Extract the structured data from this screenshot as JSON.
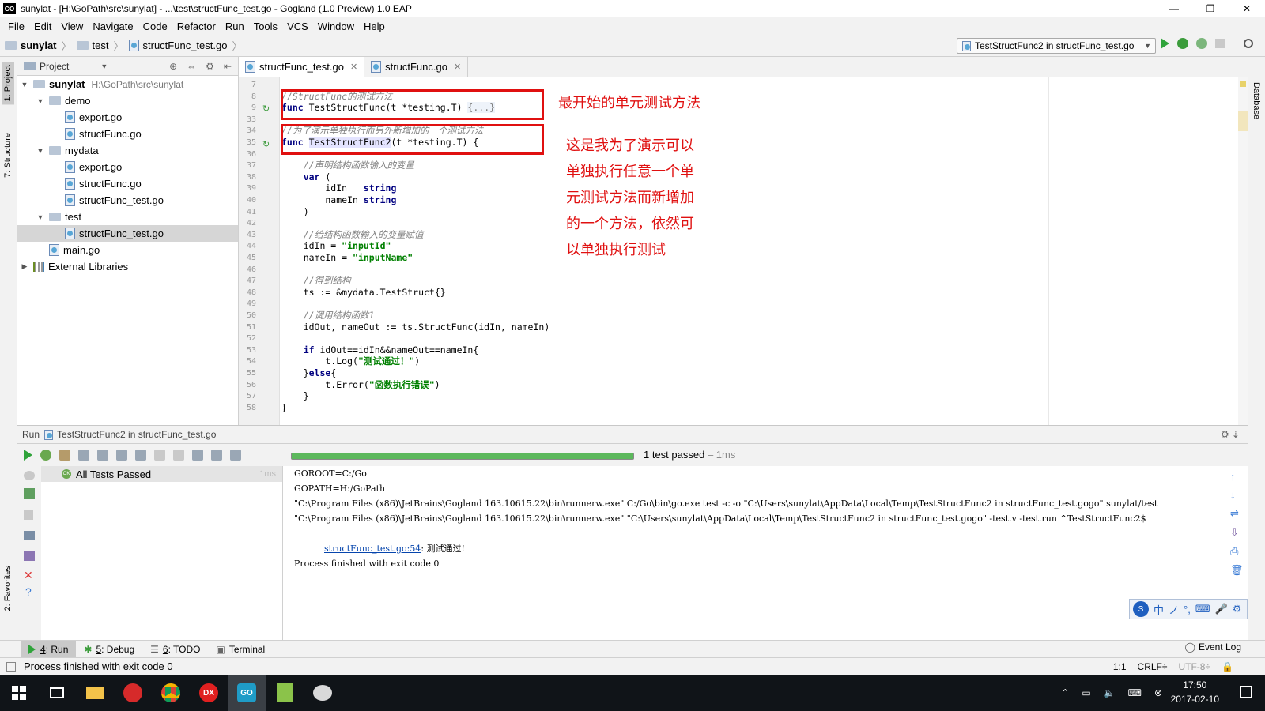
{
  "window": {
    "title": "sunylat - [H:\\GoPath\\src\\sunylat] - ...\\test\\structFunc_test.go - Gogland (1.0 Preview) 1.0 EAP",
    "app_icon": "GO",
    "minimize": "—",
    "maximize": "❐",
    "close": "✕"
  },
  "menu": [
    "File",
    "Edit",
    "View",
    "Navigate",
    "Code",
    "Refactor",
    "Run",
    "Tools",
    "VCS",
    "Window",
    "Help"
  ],
  "breadcrumb": [
    "sunylat",
    "test",
    "structFunc_test.go"
  ],
  "run_config": "TestStructFunc2 in structFunc_test.go",
  "left_stripe": {
    "project": "1: Project",
    "structure": "7: Structure",
    "favorites": "2: Favorites"
  },
  "right_stripe": {
    "database": "Database"
  },
  "project_panel": {
    "title": "Project",
    "root_label": "sunylat",
    "root_path": "H:\\GoPath\\src\\sunylat",
    "tree": [
      {
        "label": "demo",
        "depth": 1,
        "kind": "folder",
        "expanded": true
      },
      {
        "label": "export.go",
        "depth": 2,
        "kind": "file"
      },
      {
        "label": "structFunc.go",
        "depth": 2,
        "kind": "file"
      },
      {
        "label": "mydata",
        "depth": 1,
        "kind": "folder",
        "expanded": true
      },
      {
        "label": "export.go",
        "depth": 2,
        "kind": "file"
      },
      {
        "label": "structFunc.go",
        "depth": 2,
        "kind": "file"
      },
      {
        "label": "structFunc_test.go",
        "depth": 2,
        "kind": "file"
      },
      {
        "label": "test",
        "depth": 1,
        "kind": "folder",
        "expanded": true
      },
      {
        "label": "structFunc_test.go",
        "depth": 2,
        "kind": "file",
        "selected": true
      },
      {
        "label": "main.go",
        "depth": 1,
        "kind": "file"
      },
      {
        "label": "External Libraries",
        "depth": 0,
        "kind": "lib"
      }
    ]
  },
  "editor": {
    "tabs": [
      {
        "label": "structFunc_test.go",
        "active": true
      },
      {
        "label": "structFunc.go",
        "active": false
      }
    ],
    "lines": [
      {
        "num": "7",
        "html": ""
      },
      {
        "num": "8",
        "html": "<span class='cm'>//StructFunc的测试方法</span>"
      },
      {
        "num": "9",
        "html": "<span class='kw'>func</span> TestStructFunc(t *testing.T) <span class='cm' style='font-style:normal;background:#eef3fa'>{...}</span>"
      },
      {
        "num": "33",
        "html": ""
      },
      {
        "num": "34",
        "html": "<span class='cm'>//为了演示单独执行而另外新增加的一个测试方法</span>"
      },
      {
        "num": "35",
        "html": "<span class='kw'>func</span> <span style='background:#e4e4ff'>TestStructFunc2</span>(t *testing.T) {"
      },
      {
        "num": "36",
        "html": ""
      },
      {
        "num": "37",
        "html": "    <span class='cm'>//声明结构函数输入的变量</span>"
      },
      {
        "num": "38",
        "html": "    <span class='kw'>var</span> ("
      },
      {
        "num": "39",
        "html": "        idIn   <span class='kw'>string</span>"
      },
      {
        "num": "40",
        "html": "        nameIn <span class='kw'>string</span>"
      },
      {
        "num": "41",
        "html": "    )"
      },
      {
        "num": "42",
        "html": ""
      },
      {
        "num": "43",
        "html": "    <span class='cm'>//给结构函数输入的变量赋值</span>"
      },
      {
        "num": "44",
        "html": "    idIn = <span class='st'>\"inputId\"</span>"
      },
      {
        "num": "45",
        "html": "    nameIn = <span class='st'>\"inputName\"</span>"
      },
      {
        "num": "46",
        "html": ""
      },
      {
        "num": "47",
        "html": "    <span class='cm'>//得到结构</span>"
      },
      {
        "num": "48",
        "html": "    ts := &amp;mydata.TestStruct{}"
      },
      {
        "num": "49",
        "html": ""
      },
      {
        "num": "50",
        "html": "    <span class='cm'>//调用结构函数1</span>"
      },
      {
        "num": "51",
        "html": "    idOut, nameOut := ts.StructFunc(idIn, nameIn)"
      },
      {
        "num": "52",
        "html": ""
      },
      {
        "num": "53",
        "html": "    <span class='kw'>if</span> idOut==idIn&amp;&amp;nameOut==nameIn{"
      },
      {
        "num": "54",
        "html": "        t.Log(<span class='st'>\"测试通过！\"</span>)"
      },
      {
        "num": "55",
        "html": "    }<span class='kw'>else</span>{"
      },
      {
        "num": "56",
        "html": "        t.Error(<span class='st'>\"函数执行错误\"</span>)"
      },
      {
        "num": "57",
        "html": "    }"
      },
      {
        "num": "58",
        "html": "}"
      }
    ]
  },
  "annotations": {
    "first": "最开始的单元测试方法",
    "second": [
      "这是我为了演示可以",
      "单独执行任意一个单",
      "元测试方法而新增加",
      "的一个方法，依然可",
      "以单独执行测试"
    ]
  },
  "run_panel": {
    "header": "Run",
    "config": "TestStructFunc2 in structFunc_test.go",
    "progress": 1.0,
    "result": "1 test passed",
    "result_time": "– 1ms",
    "tree_item": "All Tests Passed",
    "tree_time": "1ms",
    "console": [
      "GOROOT=C:/Go",
      "GOPATH=H:/GoPath",
      "\"C:\\Program Files (x86)\\JetBrains\\Gogland 163.10615.22\\bin\\runnerw.exe\" C:/Go\\bin\\go.exe test -c -o \"C:\\Users\\sunylat\\AppData\\Local\\Temp\\TestStructFunc2 in structFunc_test.gogo\" sunylat/test",
      "\"C:\\Program Files (x86)\\JetBrains\\Gogland 163.10615.22\\bin\\runnerw.exe\" \"C:\\Users\\sunylat\\AppData\\Local\\Temp\\TestStructFunc2 in structFunc_test.gogo\" -test.v -test.run ^TestStructFunc2$"
    ],
    "log_link": "structFunc_test.go:54",
    "log_text": ": 测试通过!",
    "exit_line": "Process finished with exit code 0"
  },
  "ime": [
    "中",
    "ノ",
    "°,",
    "⌨",
    "🎤",
    "⚙"
  ],
  "toolwindows": [
    {
      "key": "4",
      "label": ": Run",
      "active": true
    },
    {
      "key": "5",
      "label": ": Debug",
      "active": false
    },
    {
      "key": "6",
      "label": ": TODO",
      "active": false
    },
    {
      "key": "",
      "label": "Terminal",
      "active": false
    }
  ],
  "event_log": "Event Log",
  "status": {
    "message": "Process finished with exit code 0",
    "position": "1:1",
    "line_sep": "CRLF÷",
    "encoding": "UTF-8÷"
  },
  "clock": {
    "time": "17:50",
    "date": "2017-02-10"
  }
}
